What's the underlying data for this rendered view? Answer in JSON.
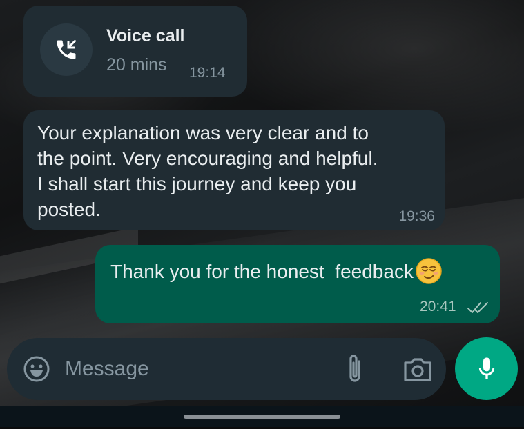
{
  "chat": {
    "call": {
      "title": "Voice call",
      "duration": "20 mins",
      "time": "19:14",
      "icon": "incoming-call-icon"
    },
    "messages": [
      {
        "direction": "incoming",
        "text": "Your explanation was very clear and to\nthe point. Very encouraging and helpful.\nI shall start this journey and keep you\nposted.",
        "time": "19:36"
      },
      {
        "direction": "outgoing",
        "text": "Thank you for the honest  feedback",
        "emoji": "smirking-face-emoji",
        "time": "20:41",
        "status": "read-double-check-icon"
      }
    ]
  },
  "composer": {
    "placeholder": "Message",
    "icons": {
      "emoji": "emoji-icon",
      "attach": "paperclip-icon",
      "camera": "camera-icon",
      "mic": "microphone-icon"
    }
  },
  "colors": {
    "incoming_bubble": "#202c33",
    "outgoing_bubble": "#005c4b",
    "accent": "#00a884",
    "meta_text": "#8696a0"
  }
}
